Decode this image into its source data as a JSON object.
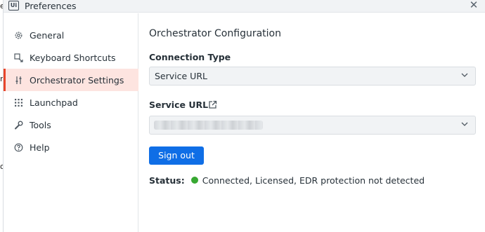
{
  "window": {
    "title": "Preferences",
    "logo_text": "Ui"
  },
  "left_edge_glyphs": [
    "e",
    "n",
    "o"
  ],
  "sidebar": {
    "items": [
      {
        "label": "General",
        "icon": "gear-icon"
      },
      {
        "label": "Keyboard Shortcuts",
        "icon": "keyboard-shortcut-icon"
      },
      {
        "label": "Orchestrator Settings",
        "icon": "sliders-icon",
        "active": true
      },
      {
        "label": "Launchpad",
        "icon": "grid-icon"
      },
      {
        "label": "Tools",
        "icon": "wrench-icon"
      },
      {
        "label": "Help",
        "icon": "help-icon"
      }
    ]
  },
  "main": {
    "title": "Orchestrator Configuration",
    "connection_type": {
      "label": "Connection Type",
      "value": "Service URL"
    },
    "service_url": {
      "label": "Service URL",
      "value_obscured": true
    },
    "sign_out_label": "Sign out",
    "status": {
      "label": "Status:",
      "text": "Connected, Licensed, EDR protection not detected",
      "color": "#38a832"
    }
  },
  "colors": {
    "accent": "#e8452b",
    "active_bg": "#fde4e0",
    "primary_button": "#0f6ee6"
  }
}
